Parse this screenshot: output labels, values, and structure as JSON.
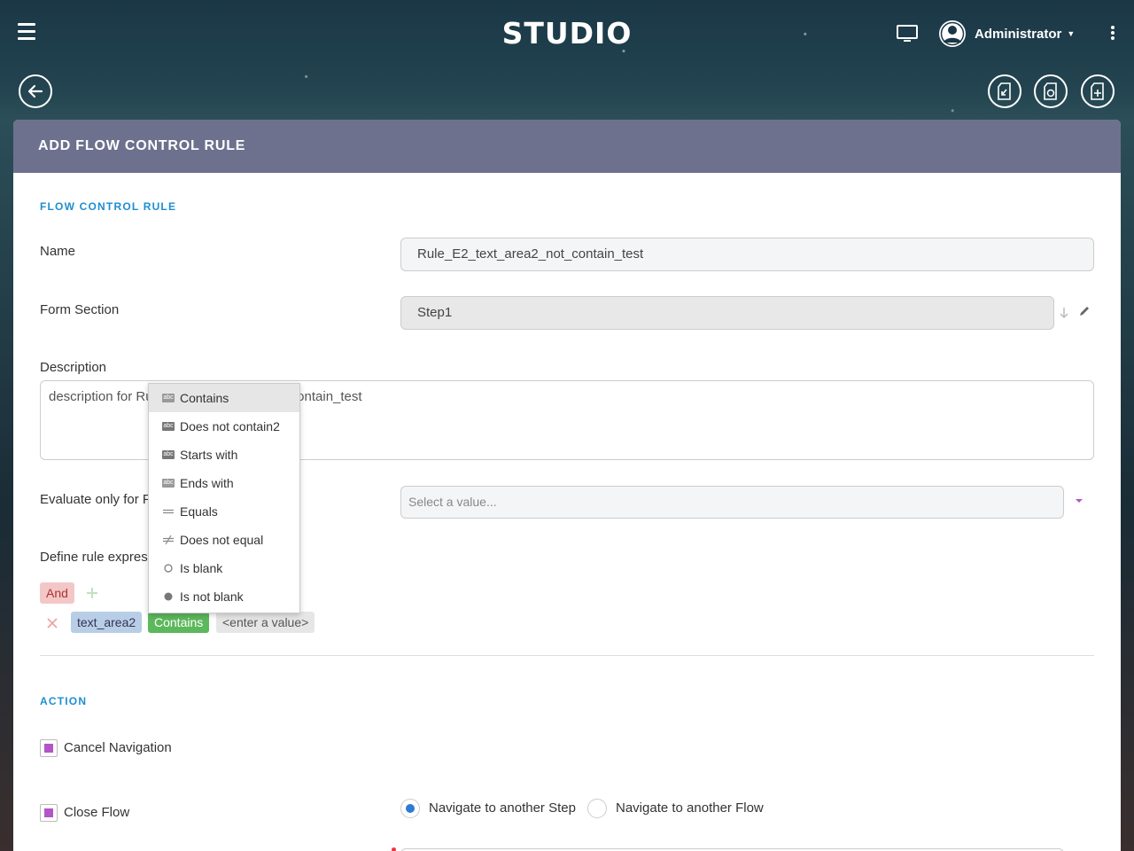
{
  "app": {
    "brand": "STUDIO",
    "user_name": "Administrator"
  },
  "card": {
    "title": "ADD FLOW CONTROL RULE"
  },
  "rule_section": {
    "title": "FLOW CONTROL RULE",
    "name_label": "Name",
    "name_value": "Rule_E2_text_area2_not_contain_test",
    "form_section_label": "Form Section",
    "form_section_value": "Step1",
    "description_label": "Description",
    "description_value": "description for Rule_E2_text_area2_not_contain_test",
    "evaluate_label": "Evaluate only for Forms with",
    "evaluate_placeholder": "Select a value...",
    "expression_label": "Define rule expression"
  },
  "expression": {
    "and_label": "And",
    "field_tag": "text_area2",
    "operator_tag": "Contains",
    "value_tag": "<enter a value>"
  },
  "operator_menu": {
    "items": [
      {
        "label": "Contains",
        "icon": "contains-icon"
      },
      {
        "label": "Does not contain2",
        "icon": "not-contains-icon"
      },
      {
        "label": "Starts with",
        "icon": "starts-with-icon"
      },
      {
        "label": "Ends with",
        "icon": "ends-with-icon"
      },
      {
        "label": "Equals",
        "icon": "equals-icon"
      },
      {
        "label": "Does not equal",
        "icon": "not-equal-icon"
      },
      {
        "label": "Is blank",
        "icon": "empty-circle-icon"
      },
      {
        "label": "Is not blank",
        "icon": "filled-circle-icon"
      }
    ]
  },
  "action_section": {
    "title": "ACTION",
    "cancel_navigation_label": "Cancel Navigation",
    "close_flow_label": "Close Flow",
    "navigate_step_label": "Navigate to another Step",
    "navigate_flow_label": "Navigate to another Flow"
  },
  "colors": {
    "header": "#6d718e",
    "accent_blue": "#1e8ed0",
    "and_tag": "#f4c7c7",
    "field_tag": "#b8cde6",
    "operator_tag": "#5cb85c",
    "checkbox": "#b455c7",
    "radio": "#2f7ad3"
  }
}
